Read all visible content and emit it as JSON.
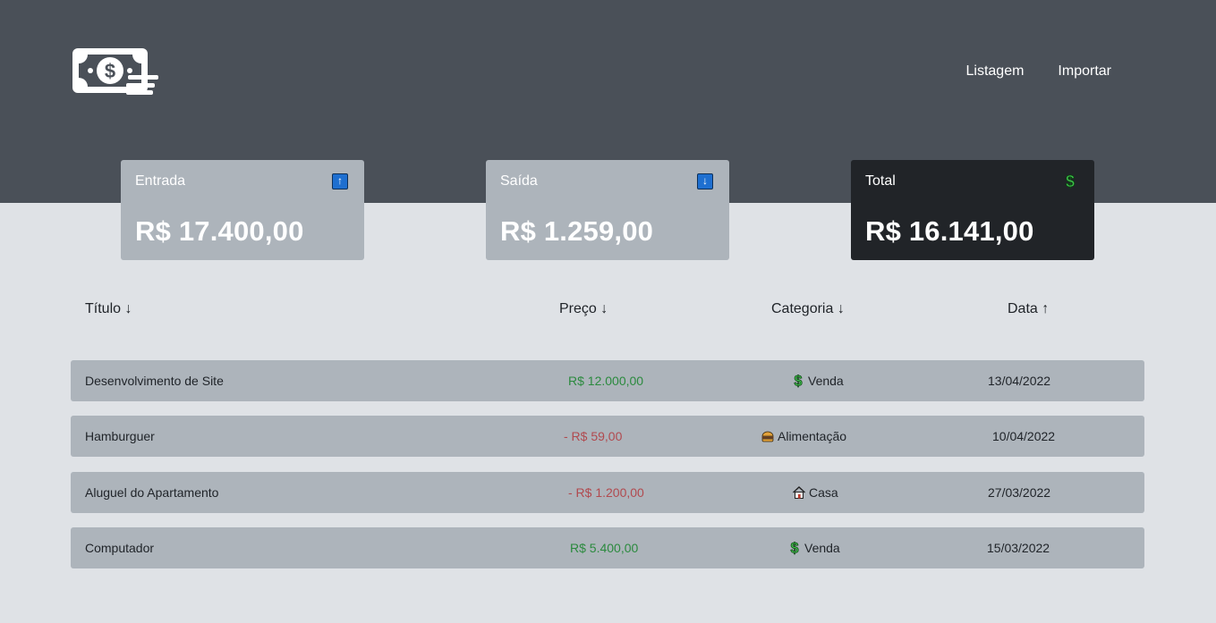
{
  "nav": {
    "items": [
      {
        "label": "Listagem"
      },
      {
        "label": "Importar"
      }
    ]
  },
  "cards": [
    {
      "label": "Entrada",
      "value": "R$ 17.400,00",
      "icon": "arrow-up-icon"
    },
    {
      "label": "Saída",
      "value": "R$ 1.259,00",
      "icon": "arrow-down-icon"
    },
    {
      "label": "Total",
      "value": "R$ 16.141,00",
      "icon": "dollar-icon"
    }
  ],
  "table": {
    "headers": {
      "title": "Título ↓",
      "price": "Preço ↓",
      "category": "Categoria ↓",
      "date": "Data ↑"
    },
    "rows": [
      {
        "title": "Desenvolvimento de Site",
        "price": "R$ 12.000,00",
        "category": "Venda",
        "category_icon": "dollar-icon",
        "date": "13/04/2022"
      },
      {
        "title": "Hamburguer",
        "price": "- R$ 59,00",
        "category": "Alimentação",
        "category_icon": "burger-icon",
        "date": "10/04/2022"
      },
      {
        "title": "Aluguel do Apartamento",
        "price": "- R$ 1.200,00",
        "category": "Casa",
        "category_icon": "house-icon",
        "date": "27/03/2022"
      },
      {
        "title": "Computador",
        "price": "R$ 5.400,00",
        "category": "Venda",
        "category_icon": "dollar-icon",
        "date": "15/03/2022"
      }
    ]
  },
  "colors": {
    "header_bg": "#4a5058",
    "page_bg": "#dfe2e6",
    "card_bg": "#adb4bb",
    "total_card_bg": "#212428",
    "positive": "#2b8a3e",
    "negative": "#b14a4f"
  }
}
